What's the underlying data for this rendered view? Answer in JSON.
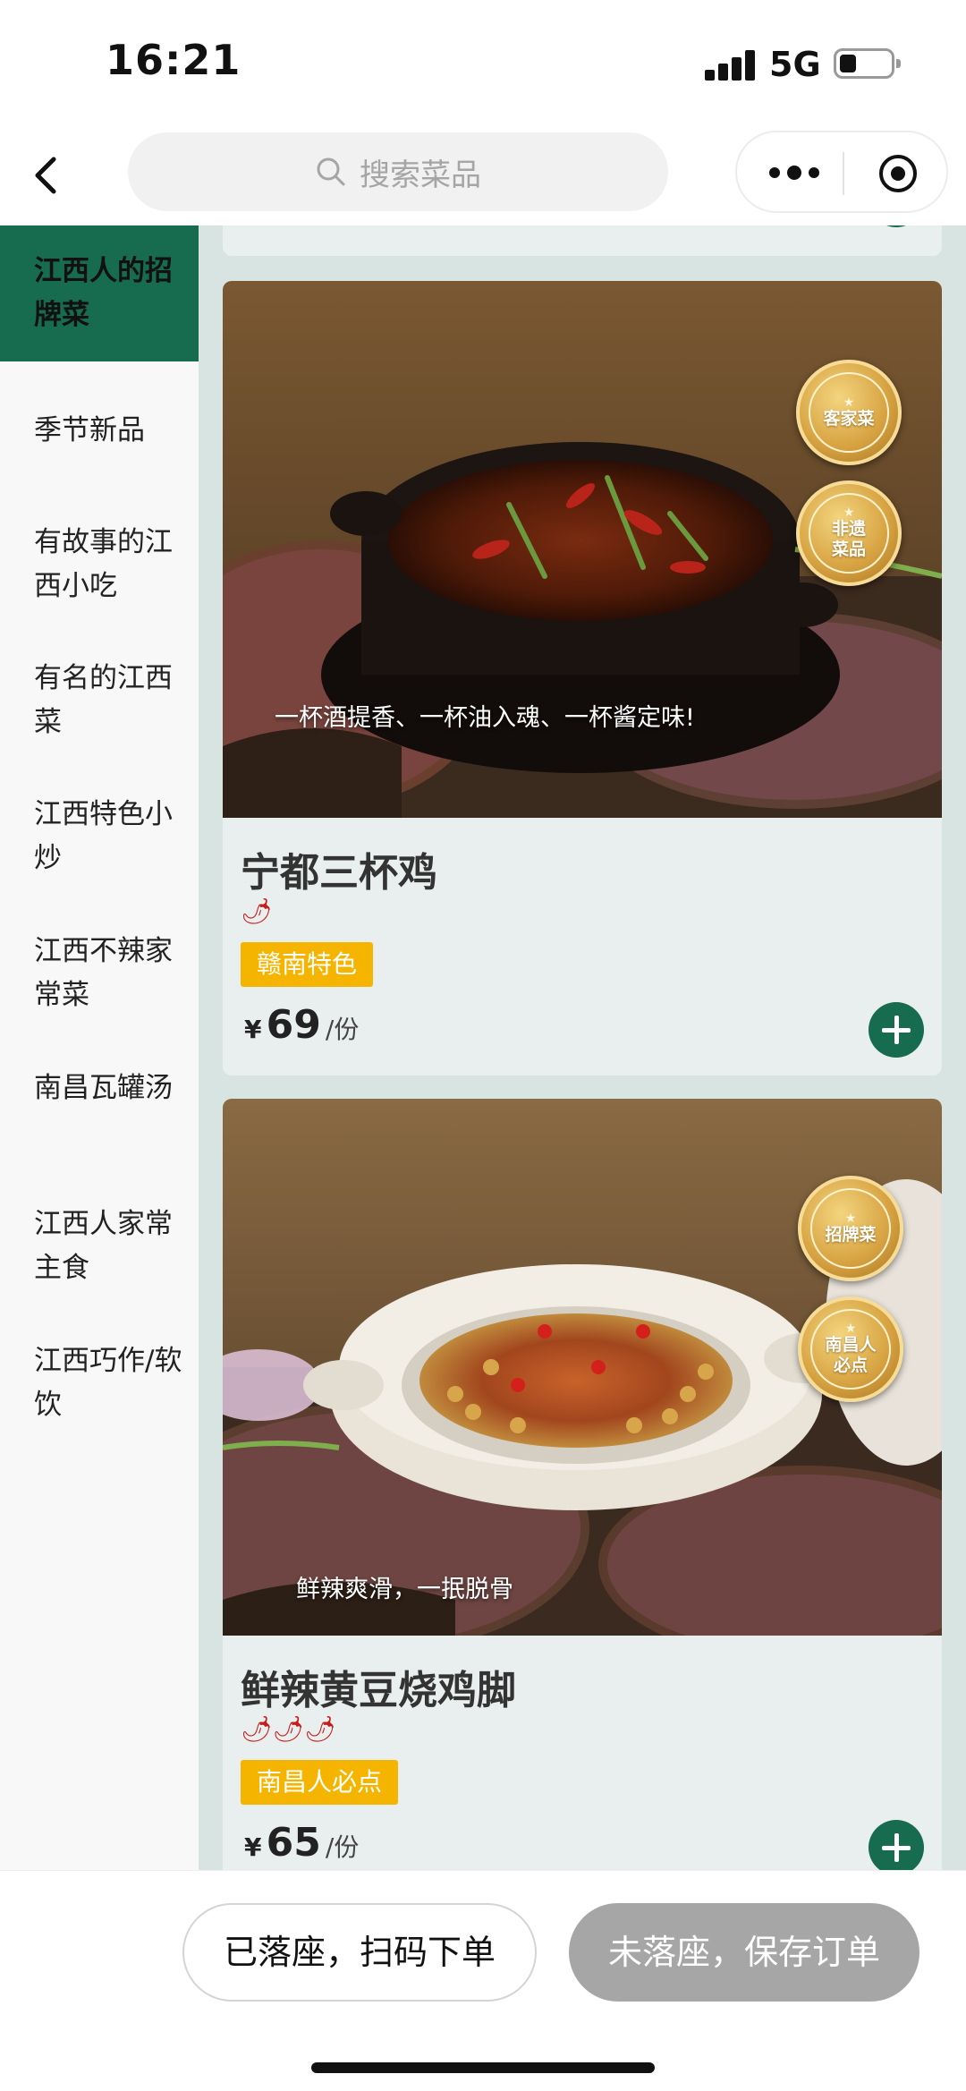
{
  "status_bar": {
    "time": "16:21",
    "network": "5G"
  },
  "nav": {
    "search_placeholder": "搜索菜品"
  },
  "sidebar": {
    "items": [
      {
        "label": "江西人的招牌菜",
        "active": true
      },
      {
        "label": "季节新品"
      },
      {
        "label": "有故事的江西小吃"
      },
      {
        "label": "有名的江西菜"
      },
      {
        "label": "江西特色小炒"
      },
      {
        "label": "江西不辣家常菜"
      },
      {
        "label": "南昌瓦罐汤"
      },
      {
        "label": "江西人家常主食"
      },
      {
        "label": "江西巧作/软饮"
      }
    ]
  },
  "dishes": [
    {
      "name": "宁都三杯鸡",
      "caption": "一杯酒提香、一杯油入魂、一杯酱定味!",
      "badges": [
        "客家菜",
        "非遗菜品"
      ],
      "spice": "🌶",
      "tag": "赣南特色",
      "currency": "¥",
      "price": "69",
      "unit": "/份"
    },
    {
      "name": "鲜辣黄豆烧鸡脚",
      "caption": "鲜辣爽滑，一抿脱骨",
      "badges": [
        "招牌菜",
        "南昌人必点"
      ],
      "spice": "🌶🌶🌶",
      "tag": "南昌人必点",
      "currency": "¥",
      "price": "65",
      "unit": "/份"
    }
  ],
  "bottom_bar": {
    "seated_label": "已落座，扫码下单",
    "not_seated_label": "未落座，保存订单"
  },
  "colors": {
    "brand_green": "#176b4f",
    "tag_yellow": "#f5b400",
    "disabled_gray": "#a6a6a6"
  }
}
